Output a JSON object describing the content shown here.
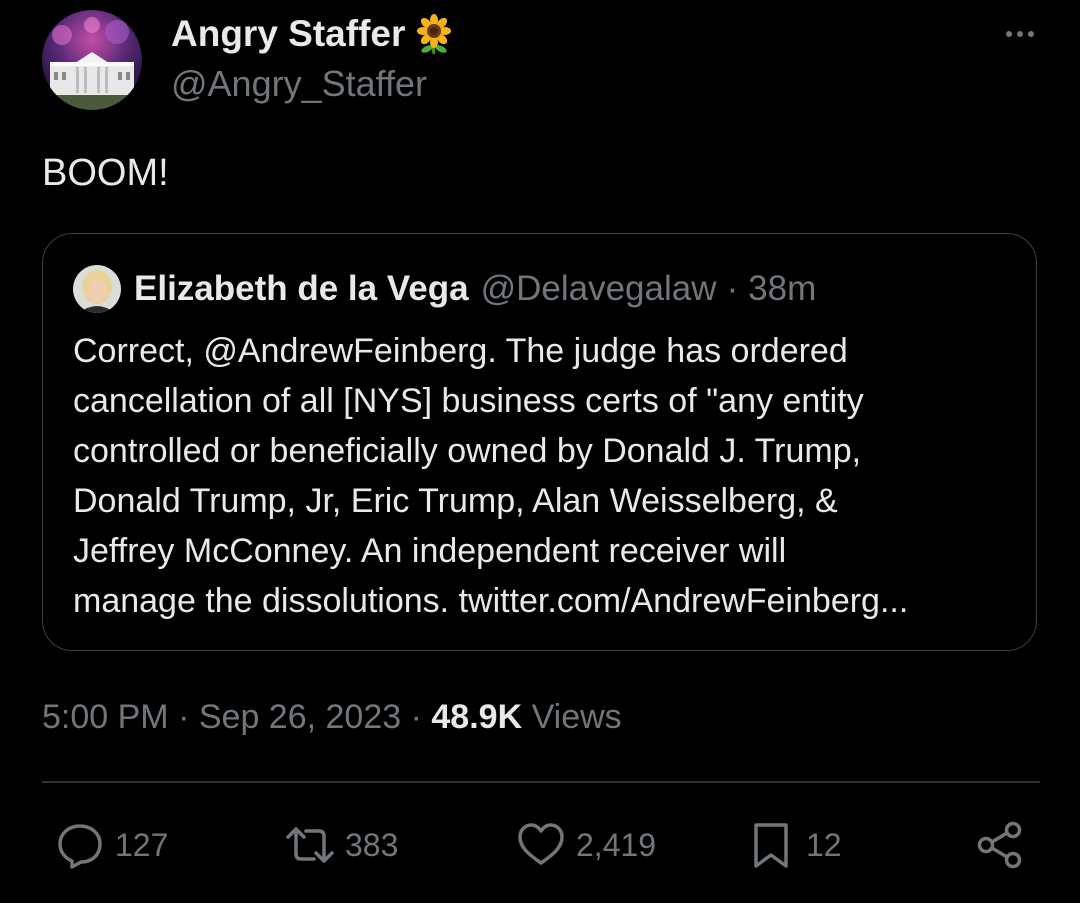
{
  "author": {
    "display_name": "Angry Staffer",
    "badge": "sunflower-emoji",
    "handle": "@Angry_Staffer"
  },
  "tweet": {
    "text": "BOOM!",
    "time": "5:00 PM",
    "date": "Sep 26, 2023",
    "views_count": "48.9K",
    "views_label": "Views"
  },
  "quoted": {
    "display_name": "Elizabeth de la Vega",
    "handle": "@Delavegalaw",
    "time": "38m",
    "text": "Correct, @AndrewFeinberg. The judge has ordered\ncancellation of all [NYS] business certs of \"any entity\ncontrolled or beneficially owned by Donald J. Trump,\nDonald Trump, Jr, Eric Trump, Alan Weisselberg, &\nJeffrey McConney. An independent receiver will\nmanage the dissolutions. twitter.com/AndrewFeinberg..."
  },
  "actions": {
    "replies": "127",
    "reposts": "383",
    "likes": "2,419",
    "bookmarks": "12"
  },
  "colors": {
    "background": "#000000",
    "text": "#e7e9ea",
    "muted": "#71767b",
    "border": "#2f3336"
  }
}
